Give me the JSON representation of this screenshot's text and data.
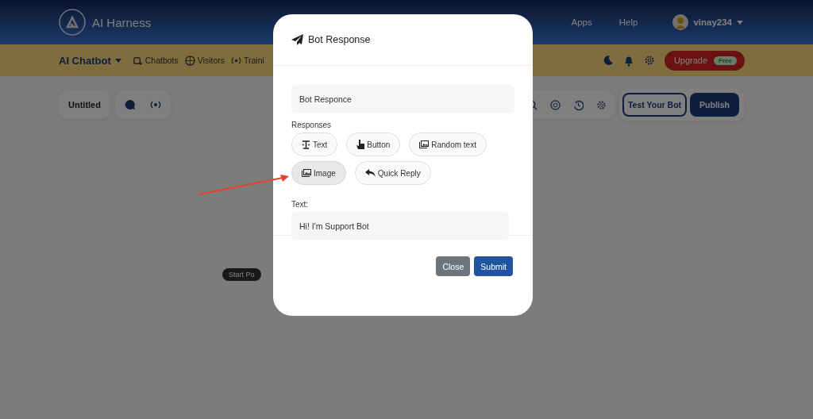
{
  "header": {
    "brand": "AI Harness",
    "links": [
      "Apps",
      "Help"
    ],
    "user": "vinay234"
  },
  "toolbar": {
    "product": "AI Chatbot",
    "nav": [
      "Chatbots",
      "Visitors",
      "Traini"
    ],
    "upgrade": "Upgrade",
    "plan": "Free"
  },
  "canvas": {
    "title": "Untitled",
    "node": "Start Po",
    "actions": [
      "Test Your Bot",
      "Publish"
    ]
  },
  "modal": {
    "title": "Bot Response",
    "name_value": "Bot Responce",
    "responses_label": "Responses",
    "response_types": [
      {
        "label": "Text",
        "kind": "text",
        "selected": false
      },
      {
        "label": "Button",
        "kind": "button",
        "selected": false
      },
      {
        "label": "Random text",
        "kind": "random",
        "selected": false
      },
      {
        "label": "Image",
        "kind": "image",
        "selected": true
      },
      {
        "label": "Quick Reply",
        "kind": "reply",
        "selected": false
      }
    ],
    "text_label": "Text:",
    "text_value": "Hi! I'm Support Bot",
    "buttons": [
      "Close",
      "Submit"
    ]
  }
}
